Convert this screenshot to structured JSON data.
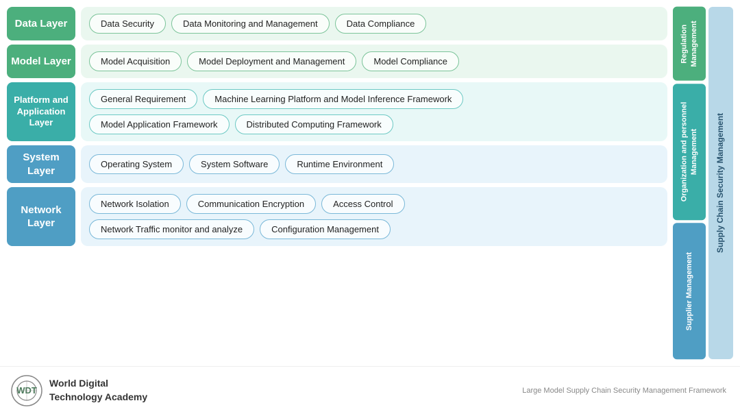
{
  "layers": [
    {
      "id": "data-layer",
      "label": "Data Layer",
      "labelColor": "green",
      "contentColor": "green-bg",
      "pillColor": "green-border",
      "rows": [
        [
          "Data Security",
          "Data Monitoring and Management",
          "Data Compliance"
        ]
      ]
    },
    {
      "id": "model-layer",
      "label": "Model Layer",
      "labelColor": "green",
      "contentColor": "green-bg",
      "pillColor": "green-border",
      "rows": [
        [
          "Model Acquisition",
          "Model Deployment and Management",
          "Model Compliance"
        ]
      ]
    },
    {
      "id": "platform-layer",
      "label": "Platform and Application Layer",
      "labelColor": "teal",
      "contentColor": "teal-bg",
      "pillColor": "teal-border",
      "rows": [
        [
          "General Requirement",
          "Machine Learning Platform and Model Inference Framework"
        ],
        [
          "Model Application Framework",
          "Distributed Computing Framework"
        ]
      ]
    },
    {
      "id": "system-layer",
      "label": "System Layer",
      "labelColor": "blue",
      "contentColor": "blue-bg",
      "pillColor": "blue-border",
      "rows": [
        [
          "Operating System",
          "System Software",
          "Runtime Environment"
        ]
      ]
    },
    {
      "id": "network-layer",
      "label": "Network Layer",
      "labelColor": "blue2",
      "contentColor": "blue2-bg",
      "pillColor": "blue-border",
      "rows": [
        [
          "Network Isolation",
          "Communication Encryption",
          "Access Control"
        ],
        [
          "Network Traffic monitor and analyze",
          "Configuration Management"
        ]
      ]
    }
  ],
  "rightPanel": {
    "supplyChainLabel": "Supply Chain Security Management",
    "segments": [
      {
        "id": "reg",
        "label": "Regulation Management",
        "color": "reg-mgmt",
        "spans": 1
      },
      {
        "id": "org",
        "label": "Organization and personnel Management",
        "color": "org-mgmt",
        "spans": 2
      },
      {
        "id": "sup",
        "label": "Supplier Management",
        "color": "sup-mgmt",
        "spans": 2
      }
    ]
  },
  "footer": {
    "orgLine1": "World Digital",
    "orgLine2": "Technology Academy",
    "footerNote": "Large Model Supply Chain Security Management Framework"
  }
}
